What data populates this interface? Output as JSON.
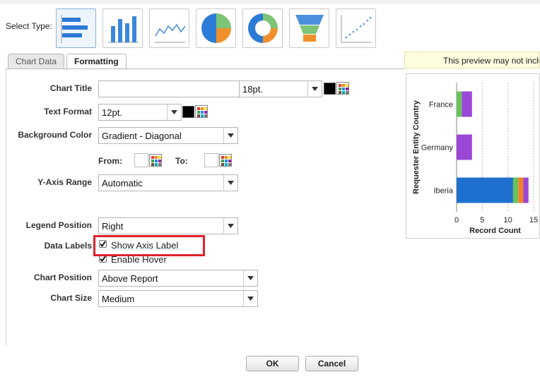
{
  "select_type_label": "Select Type:",
  "chart_types": [
    {
      "name": "horizontal-bar",
      "selected": true
    },
    {
      "name": "vertical-bar",
      "selected": false
    },
    {
      "name": "line",
      "selected": false
    },
    {
      "name": "pie",
      "selected": false
    },
    {
      "name": "donut",
      "selected": false
    },
    {
      "name": "funnel",
      "selected": false
    },
    {
      "name": "scatter",
      "selected": false
    }
  ],
  "tabs": [
    {
      "label": "Chart Data",
      "active": false
    },
    {
      "label": "Formatting",
      "active": true
    }
  ],
  "form": {
    "chart_title": {
      "label": "Chart Title",
      "value": "",
      "size": "18pt."
    },
    "text_format": {
      "label": "Text Format",
      "size": "12pt."
    },
    "background_color": {
      "label": "Background Color",
      "value": "Gradient - Diagonal"
    },
    "from_label": "From:",
    "to_label": "To:",
    "y_axis_range": {
      "label": "Y-Axis Range",
      "value": "Automatic"
    },
    "legend_position": {
      "label": "Legend Position",
      "value": "Right"
    },
    "data_labels": {
      "label": "Data Labels"
    },
    "show_axis_label": {
      "label": "Show Axis Label",
      "checked": true
    },
    "enable_hover": {
      "label": "Enable Hover",
      "checked": true
    },
    "chart_position": {
      "label": "Chart Position",
      "value": "Above Report"
    },
    "chart_size": {
      "label": "Chart Size",
      "value": "Medium"
    }
  },
  "preview": {
    "note": "This preview may not inclu",
    "ylabel": "Requester Entity Country",
    "xlabel": "Record Count",
    "categories": [
      "France",
      "Germany",
      "Iberia"
    ],
    "x_ticks": [
      "0",
      "5",
      "10",
      "15"
    ],
    "series": [
      {
        "color": "#1f6fce",
        "values": [
          0,
          0,
          11
        ]
      },
      {
        "color": "#6ac259",
        "values": [
          1,
          0,
          1
        ]
      },
      {
        "color": "#f0802b",
        "values": [
          0,
          0,
          1
        ]
      },
      {
        "color": "#9a47d6",
        "values": [
          2,
          3,
          1
        ]
      }
    ],
    "xlim": [
      0,
      15
    ]
  },
  "buttons": {
    "ok": "OK",
    "cancel": "Cancel"
  },
  "colors": {
    "highlight": "#e0212b",
    "accent": "#1f6fce"
  }
}
